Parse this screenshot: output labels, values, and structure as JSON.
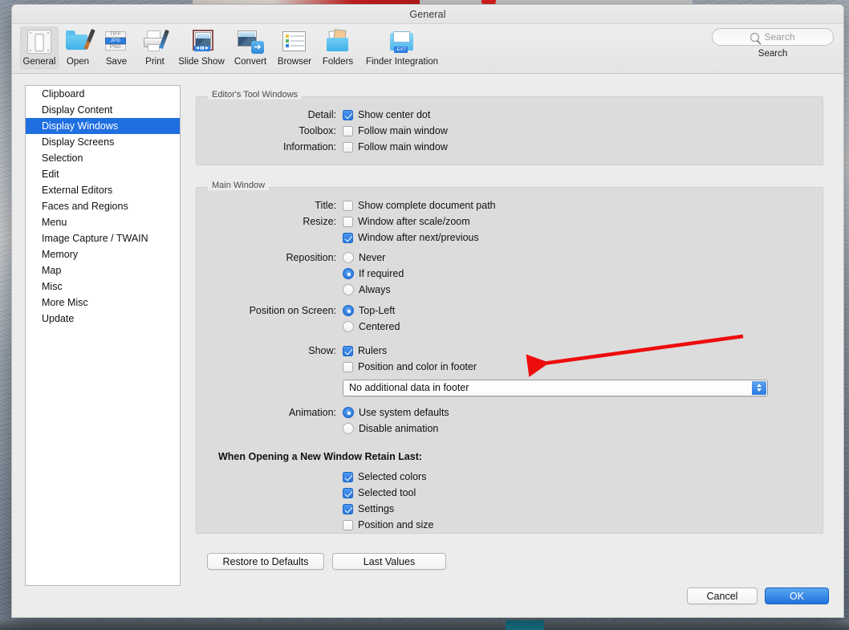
{
  "window": {
    "title": "General"
  },
  "toolbar": {
    "items": [
      {
        "label": "General",
        "icon": "general-icon",
        "selected": true
      },
      {
        "label": "Open",
        "icon": "open-folder-brush-icon",
        "selected": false
      },
      {
        "label": "Save",
        "icon": "save-formats-icon",
        "selected": false
      },
      {
        "label": "Print",
        "icon": "printer-icon",
        "selected": false
      },
      {
        "label": "Slide Show",
        "icon": "slideshow-icon",
        "selected": false
      },
      {
        "label": "Convert",
        "icon": "convert-arrow-icon",
        "selected": false
      },
      {
        "label": "Browser",
        "icon": "browser-list-icon",
        "selected": false
      },
      {
        "label": "Folders",
        "icon": "folders-photos-icon",
        "selected": false
      },
      {
        "label": "Finder Integration",
        "icon": "finder-ext-icon",
        "selected": false
      }
    ],
    "search": {
      "placeholder": "Search",
      "value": "",
      "icon": "search-icon",
      "caption": "Search"
    }
  },
  "sidebar": {
    "items": [
      {
        "label": "Clipboard",
        "selected": false
      },
      {
        "label": "Display Content",
        "selected": false
      },
      {
        "label": "Display Windows",
        "selected": true
      },
      {
        "label": "Display Screens",
        "selected": false
      },
      {
        "label": "Selection",
        "selected": false
      },
      {
        "label": "Edit",
        "selected": false
      },
      {
        "label": "External Editors",
        "selected": false
      },
      {
        "label": "Faces and Regions",
        "selected": false
      },
      {
        "label": "Menu",
        "selected": false
      },
      {
        "label": "Image Capture / TWAIN",
        "selected": false
      },
      {
        "label": "Memory",
        "selected": false
      },
      {
        "label": "Map",
        "selected": false
      },
      {
        "label": "Misc",
        "selected": false
      },
      {
        "label": "More Misc",
        "selected": false
      },
      {
        "label": "Update",
        "selected": false
      }
    ]
  },
  "editor_tool_windows": {
    "title": "Editor's Tool Windows",
    "rows": [
      {
        "label": "Detail:",
        "option": "Show center dot",
        "type": "checkbox",
        "checked": true
      },
      {
        "label": "Toolbox:",
        "option": "Follow main window",
        "type": "checkbox",
        "checked": false
      },
      {
        "label": "Information:",
        "option": "Follow main window",
        "type": "checkbox",
        "checked": false
      }
    ]
  },
  "main_window": {
    "title": "Main Window",
    "title_row": {
      "label": "Title:",
      "option": "Show complete document path",
      "checked": false
    },
    "resize_row": {
      "label": "Resize:",
      "options": [
        {
          "option": "Window after scale/zoom",
          "checked": false
        },
        {
          "option": "Window after next/previous",
          "checked": true
        }
      ]
    },
    "reposition": {
      "label": "Reposition:",
      "options": [
        {
          "option": "Never",
          "selected": false
        },
        {
          "option": "If required",
          "selected": true
        },
        {
          "option": "Always",
          "selected": false
        }
      ]
    },
    "position_on_screen": {
      "label": "Position on Screen:",
      "options": [
        {
          "option": "Top-Left",
          "selected": true
        },
        {
          "option": "Centered",
          "selected": false
        }
      ]
    },
    "show": {
      "label": "Show:",
      "options": [
        {
          "option": "Rulers",
          "checked": true
        },
        {
          "option": "Position and color in footer",
          "checked": false
        }
      ]
    },
    "footer_popup": {
      "value": "No additional data in footer",
      "icon": "chevron-updown-icon"
    },
    "animation": {
      "label": "Animation:",
      "options": [
        {
          "option": "Use system defaults",
          "selected": true
        },
        {
          "option": "Disable animation",
          "selected": false
        }
      ]
    },
    "retain": {
      "heading": "When Opening a New Window Retain Last:",
      "options": [
        {
          "option": "Selected colors",
          "checked": true
        },
        {
          "option": "Selected tool",
          "checked": true
        },
        {
          "option": "Settings",
          "checked": true
        },
        {
          "option": "Position and size",
          "checked": false
        }
      ]
    }
  },
  "panel_buttons": {
    "restore": "Restore to Defaults",
    "last_values": "Last Values"
  },
  "footer": {
    "cancel": "Cancel",
    "ok": "OK"
  },
  "annotation": {
    "type": "red-arrow",
    "color": "#ee0c0c",
    "points_to": "Position and color in footer"
  },
  "icon_glyphs": {
    "save_formats": [
      "TIFF",
      "JPG",
      "PNG"
    ],
    "finder_ext": ".EXT",
    "slideshow_controls": "◀ ▮▮ ▶"
  }
}
